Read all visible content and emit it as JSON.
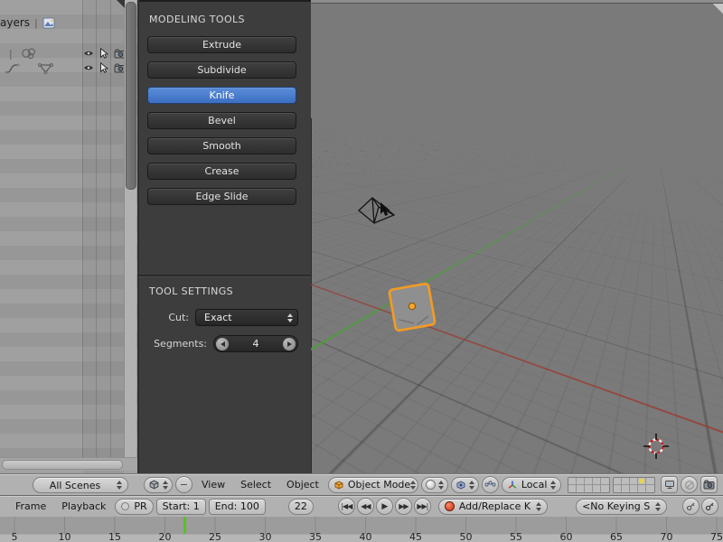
{
  "outliner": {
    "header_label": "ayers",
    "scene_selector": "All Scenes"
  },
  "tools_panel": {
    "title": "MODELING TOOLS",
    "buttons": [
      "Extrude",
      "Subdivide",
      "Knife",
      "Bevel",
      "Smooth",
      "Crease",
      "Edge Slide"
    ],
    "active_button": "Knife",
    "settings": {
      "title": "TOOL SETTINGS",
      "cut_label": "Cut:",
      "cut_value": "Exact",
      "segments_label": "Segments:",
      "segments_value": "4"
    }
  },
  "view_header": {
    "menus": [
      "View",
      "Select",
      "Object"
    ],
    "mode_value": "Object Mode",
    "orientation_value": "Local"
  },
  "timeline": {
    "menus": [
      "Frame",
      "Playback"
    ],
    "pr_label": "PR",
    "start_value": "Start: 1",
    "end_value": "End: 100",
    "current_frame": "22",
    "record_value": "Add/Replace K",
    "keying_value": "<No Keying S",
    "playhead_frame": 22,
    "ruler": [
      "5",
      "10",
      "15",
      "20",
      "25",
      "30",
      "35",
      "40",
      "45",
      "50",
      "55",
      "60",
      "65",
      "70",
      "75"
    ]
  },
  "colors": {
    "accent_blue": "#4a7dd0",
    "selection_orange": "#f59b22",
    "axis_green": "#4d9c3e",
    "axis_red": "#96423a",
    "playhead_green": "#54c41e",
    "active_layer_yellow": "#e8d44d"
  },
  "icons": {
    "picture-icon": "framed image",
    "object-data-icon": "circle cluster",
    "curve-icon": "s-curve",
    "mesh-data-icon": "vertex triangle",
    "eye-icon": "visibility eye",
    "cursor-icon": "selectability arrow",
    "camera-icon": "renderability camera",
    "editor-type-icon": "cube",
    "collapse-menu-icon": "minus circle",
    "object-mode-cube-icon": "orange cube",
    "shading-sphere-icon": "white sphere",
    "pivot-icon": "cube with dot",
    "manipulator-handles-icon": "linked dots",
    "axis-gizmo-icon": "rgb axes",
    "screen-icon": "monitor",
    "snap-icon": "slashed circle",
    "render-camera-icon": "camera",
    "record-icon": "red dot",
    "key-icon": "key",
    "speaker-icon": "speaker",
    "cursor-3d": "red white dashed circle crosshair"
  }
}
